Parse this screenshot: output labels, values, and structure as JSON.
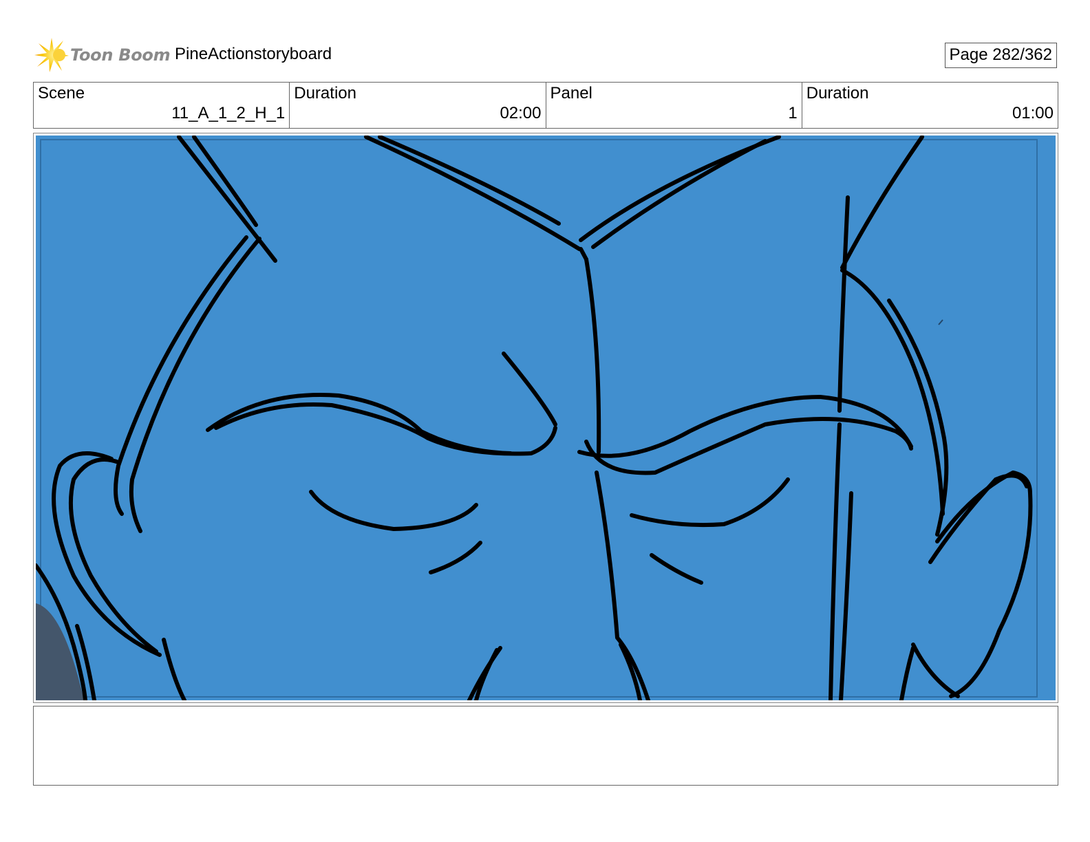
{
  "header": {
    "brand_name": "Toon Boom",
    "logo_icon": "starburst-icon",
    "project_title": "PineActionstoryboard",
    "page_label": "Page 282/362"
  },
  "info": {
    "scene_label": "Scene",
    "scene_value": "11_A_1_2_H_1",
    "scene_duration_label": "Duration",
    "scene_duration_value": "02:00",
    "panel_label": "Panel",
    "panel_value": "1",
    "panel_duration_label": "Duration",
    "panel_duration_value": "01:00"
  },
  "panel": {
    "background_color": "#418fcf",
    "line_color": "#000000",
    "shadow_color": "#44566b"
  },
  "notes": {
    "text": ""
  }
}
